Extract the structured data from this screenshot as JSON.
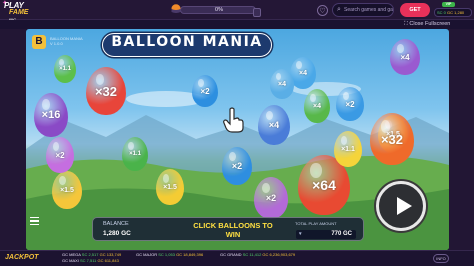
{
  "header": {
    "logo_top": "PLAY",
    "logo_bottom": "FAME",
    "logo_suffix": "INC",
    "progress_label": "0%",
    "progress_value": 0,
    "search_placeholder": "Search games and game pr",
    "get_coins_label": "GET COINS",
    "balance_chip": "VIP",
    "balance_sc": "SC 0",
    "balance_gc": "GC 1,280"
  },
  "subheader": {
    "close_fullscreen": "Close Fullscreen"
  },
  "game": {
    "brand_letter": "B",
    "brand_text_1": "BALLOON MANIA",
    "brand_text_2": "V 1.0.0",
    "title": "BALLOON MANIA",
    "hud": {
      "balance_label": "BALANCE",
      "balance_value": "1,280 GC",
      "cta": "CLICK BALLOONS TO WIN",
      "bet_label": "TOTAL PLAY AMOUNT",
      "bet_value": "770 GC",
      "bet_icon": "▾"
    },
    "balloons": [
      {
        "label": "×32",
        "color": "#e8453a"
      },
      {
        "label": "×16",
        "color": "#8a4ac6"
      },
      {
        "label": "×2",
        "color": "#2d8fe0"
      },
      {
        "label": "×4",
        "color": "#4a7cd8"
      },
      {
        "label": "×1.1",
        "color": "#5cbf4a"
      },
      {
        "label": "×4",
        "color": "#9a5ad0"
      },
      {
        "label": "×1.5",
        "color": "#f4d23a"
      },
      {
        "label": "×1.1",
        "color": "#4ab34a"
      },
      {
        "label": "×2",
        "color": "#2e8ee0"
      },
      {
        "label": "×4",
        "color": "#4aa8e8"
      },
      {
        "label": "×1.5",
        "color": "#f5c63a"
      },
      {
        "label": "×64",
        "color": "#e84a32"
      },
      {
        "label": "×32",
        "color": "#ef6a2a"
      },
      {
        "label": "×2",
        "color": "#3a9ae4"
      },
      {
        "label": "×4",
        "color": "#58b84a"
      },
      {
        "label": "×1.1",
        "color": "#f5d43a"
      },
      {
        "label": "×2",
        "color": "#b36ad8"
      },
      {
        "label": "×1.5",
        "color": "#f4cc34"
      },
      {
        "label": "×4",
        "color": "#5aaee6"
      },
      {
        "label": "×2",
        "color": "#c56ee0"
      }
    ]
  },
  "jackpot": {
    "label": "JACKPOT",
    "tiers": [
      {
        "name": "GC MEGA",
        "sc": "SC 2,517",
        "gc": "GC 133,749"
      },
      {
        "name": "GC MAXI",
        "sc": "SC 7,511",
        "gc": "GC 611,843"
      },
      {
        "name": "GC MAJOR",
        "sc": "SC 1,053",
        "gc": "GC 18,849,396"
      },
      {
        "name": "GC GRAND",
        "sc": "SC 11,412",
        "gc": "GC 6,236,903,679"
      }
    ],
    "info_label": "INFO"
  },
  "colors": {
    "accent": "#e8315a",
    "gold": "#f3c03a",
    "sc_green": "#55d36a",
    "frame_bg": "#221634"
  },
  "icons": {
    "search": "search-icon",
    "heart": "heart-icon",
    "play": "play-icon",
    "menu": "menu-icon",
    "fullscreen": "fullscreen-icon"
  }
}
